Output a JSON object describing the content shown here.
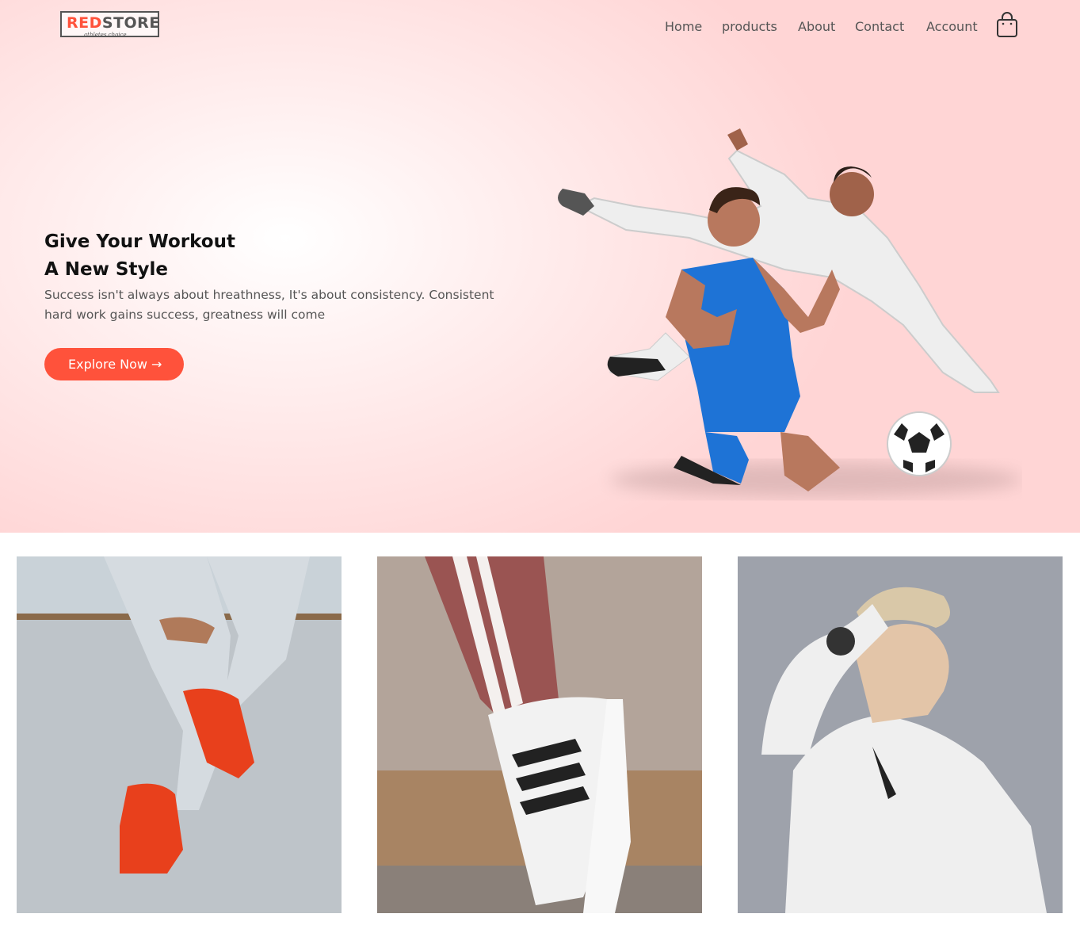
{
  "logo": {
    "main_red": "RED",
    "main_rest": "STORE",
    "tagline": "athletes choice"
  },
  "nav": [
    {
      "label": "Home"
    },
    {
      "label": "products"
    },
    {
      "label": "About"
    },
    {
      "label": "Contact"
    },
    {
      "label": "Account"
    }
  ],
  "cart": {
    "icon": "shopping-bag-icon"
  },
  "hero": {
    "title_line1": "Give Your Workout",
    "title_line2": "A New Style",
    "text": "Success isn't always about hreathness, It's about consistency. Consistent hard work gains success, greatness will come",
    "cta_label": "Explore Now →",
    "image": "soccer-players-image"
  },
  "categories": [
    {
      "image": "red-sneakers-image"
    },
    {
      "image": "white-striped-sneaker-image"
    },
    {
      "image": "woman-white-hoodie-image"
    }
  ],
  "colors": {
    "accent": "#ff523b",
    "hero_bg": "#ffd6d6",
    "text": "#555555"
  }
}
